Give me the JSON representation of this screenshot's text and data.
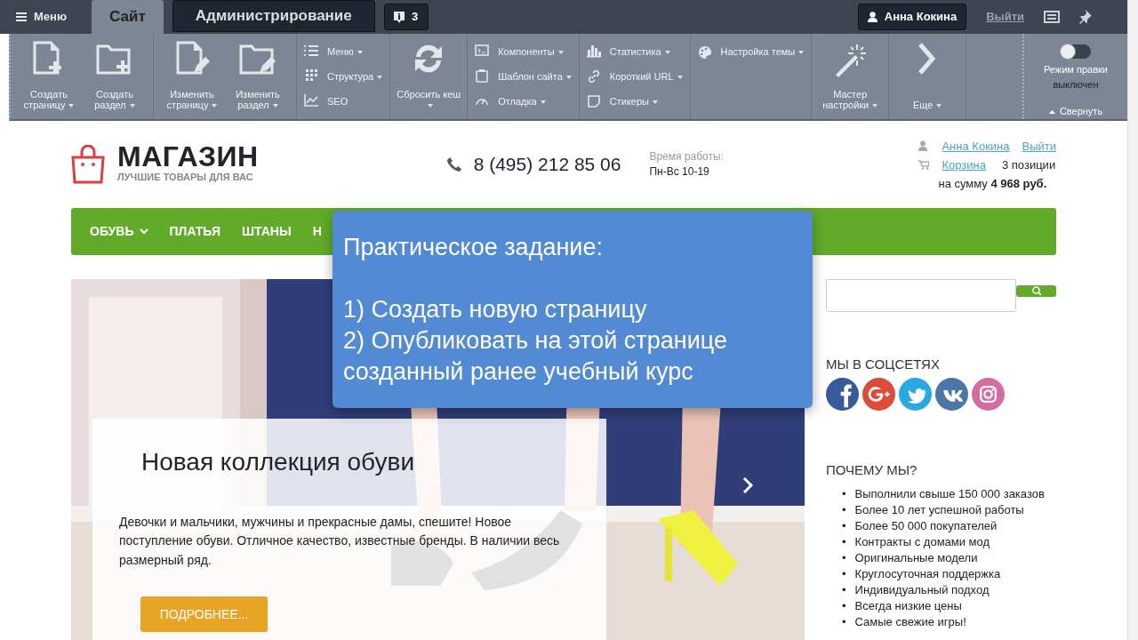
{
  "admin_bar": {
    "menu_label": "Меню",
    "tabs": [
      {
        "label": "Сайт",
        "selected": true
      },
      {
        "label": "Администрирование",
        "selected": false
      }
    ],
    "notifications_count": "3",
    "user": "Анна Кокина",
    "logout": "Выйти"
  },
  "toolbar": [
    {
      "kind": "big",
      "items": [
        {
          "label": "Создать страницу",
          "dropdown": true
        },
        {
          "label": "Создать раздел",
          "dropdown": true
        }
      ]
    },
    {
      "kind": "big",
      "items": [
        {
          "label": "Изменить страницу",
          "dropdown": true
        },
        {
          "label": "Изменить раздел",
          "dropdown": true
        }
      ]
    },
    {
      "kind": "list",
      "items": [
        {
          "label": "Меню",
          "dropdown": true
        },
        {
          "label": "Структура",
          "dropdown": true
        },
        {
          "label": "SEO",
          "dropdown": false
        }
      ]
    },
    {
      "kind": "big",
      "items": [
        {
          "label": "Сбросить кеш",
          "dropdown": true
        }
      ]
    },
    {
      "kind": "list",
      "items": [
        {
          "label": "Компоненты",
          "dropdown": true
        },
        {
          "label": "Шаблон сайта",
          "dropdown": true
        },
        {
          "label": "Отладка",
          "dropdown": true
        }
      ]
    },
    {
      "kind": "list",
      "items": [
        {
          "label": "Статистика",
          "dropdown": true
        },
        {
          "label": "Короткий URL",
          "dropdown": true
        },
        {
          "label": "Стикеры",
          "dropdown": true
        }
      ]
    },
    {
      "kind": "list",
      "items": [
        {
          "label": "Настройка темы",
          "dropdown": true
        }
      ]
    },
    {
      "kind": "big",
      "items": [
        {
          "label": "Мастер настройки",
          "dropdown": true
        }
      ]
    },
    {
      "kind": "big",
      "items": [
        {
          "label": "Еще",
          "dropdown": true
        }
      ]
    }
  ],
  "edit_mode": {
    "label": "Режим правки",
    "state": "выключен",
    "on": false,
    "collapse": "Свернуть"
  },
  "header": {
    "logo_title": "МАГАЗИН",
    "logo_tagline": "ЛУЧШИЕ ТОВАРЫ ДЛЯ ВАС",
    "phone": "8 (495) 212 85 06",
    "hours_label": "Время работы:",
    "hours": "Пн-Вс 10-19",
    "user_link": "Анна Кокина",
    "logout_link": "Выйти",
    "cart_link": "Корзина",
    "cart_count": "3 позиции",
    "cart_sum": "на сумму **4 968 руб.**"
  },
  "nav": [
    {
      "label": "ОБУВЬ",
      "dropdown": true
    },
    {
      "label": "ПЛАТЬЯ",
      "dropdown": false
    },
    {
      "label": "ШТАНЫ",
      "dropdown": false
    },
    {
      "label": "Н",
      "dropdown": false
    }
  ],
  "task_overlay": {
    "title": "Практическое задание:",
    "steps": [
      "1) Создать новую страницу",
      "2) Опубликовать на этой странице созданный ранее учебный курс"
    ]
  },
  "hero": {
    "title": "Новая коллекция обуви",
    "text": "Девочки и мальчики, мужчины и прекрасные дамы, спешите! Новое поступление обуви. Отличное качество, известные бренды. В наличии весь размерный ряд.",
    "button": "ПОДРОБНЕЕ..."
  },
  "sidebar": {
    "socials_heading": "МЫ В СОЦСЕТЯХ",
    "socials": [
      {
        "color": "#365a9b"
      },
      {
        "color": "#dd4b39"
      },
      {
        "color": "#29a9e1"
      },
      {
        "color": "#4a76a8"
      },
      {
        "color": "#d46ba3"
      }
    ],
    "why_heading": "ПОЧЕМУ МЫ?",
    "why_items": [
      {
        "marker": "•",
        "text": "Выполнили свыше 150 000 заказов"
      },
      {
        "marker": "•",
        "text": "Более 10 лет успешной работы"
      },
      {
        "marker": "•",
        "text": "Более 50 000 покупателей"
      },
      {
        "marker": "•",
        "text": "Контракты с домами мод"
      },
      {
        "marker": "•",
        "text": "Оригинальные модели"
      },
      {
        "marker": "•",
        "text": "Круглосуточная поддержка"
      },
      {
        "marker": "•",
        "text": "Индивидуальный подход"
      },
      {
        "marker": "•",
        "text": "Всегда низкие цены"
      },
      {
        "marker": "•",
        "text": "Самые свежие игры!"
      }
    ]
  }
}
